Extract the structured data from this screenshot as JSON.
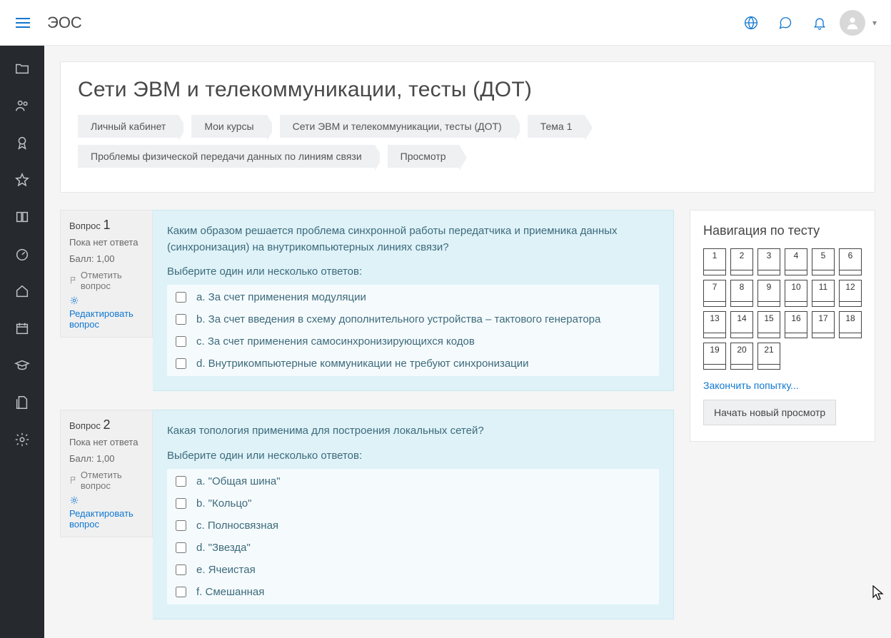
{
  "brand": "ЭОС",
  "page_title": "Сети ЭВМ и телекоммуникации, тесты (ДОТ)",
  "breadcrumbs": [
    "Личный кабинет",
    "Мои курсы",
    "Сети ЭВМ и телекоммуникации, тесты (ДОТ)",
    "Тема 1",
    "Проблемы физической передачи данных по линиям связи",
    "Просмотр"
  ],
  "labels": {
    "question_word": "Вопрос",
    "no_answer": "Пока нет ответа",
    "score": "Балл: 1,00",
    "flag": "Отметить вопрос",
    "edit": "Редактировать вопрос",
    "choose_prompt": "Выберите один или несколько ответов:",
    "nav_title": "Навигация по тесту",
    "finish_attempt": "Закончить попытку...",
    "new_preview": "Начать новый просмотр"
  },
  "questions": [
    {
      "num": "1",
      "text": "Каким образом решается проблема синхронной работы передатчика и приемника данных (синхронизация) на внутрикомпьютерных линиях связи?",
      "answers": [
        "a. За счет применения модуляции",
        "b. За счет введения в схему дополнительного устройства – тактового генератора",
        "c. За счет применения самосинхронизирующихся кодов",
        "d. Внутрикомпьютерные коммуникации не требуют синхронизации"
      ]
    },
    {
      "num": "2",
      "text": "Какая топология применима для построения локальных сетей?",
      "answers": [
        "a. \"Общая шина\"",
        "b. \"Кольцо\"",
        "c. Полносвязная",
        "d. \"Звезда\"",
        "e. Ячеистая",
        "f. Смешанная"
      ]
    }
  ],
  "nav_count": 21,
  "sidebar_icons": [
    "folder",
    "users",
    "badge",
    "star",
    "book",
    "dashboard",
    "home",
    "calendar",
    "graduation",
    "files",
    "settings"
  ]
}
